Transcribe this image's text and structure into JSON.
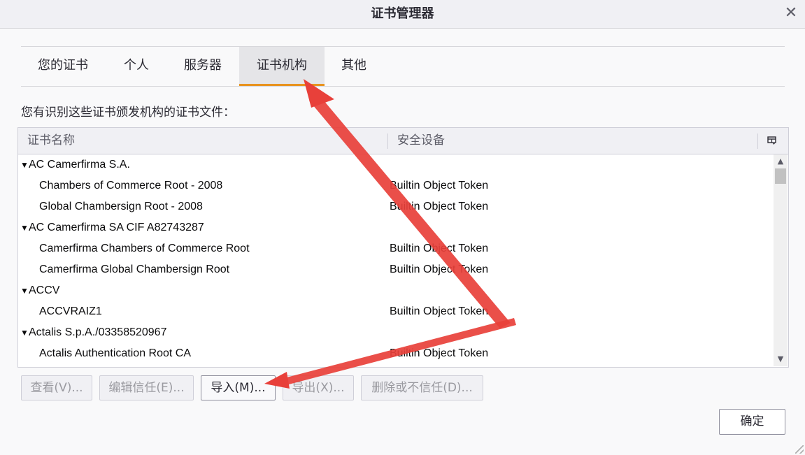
{
  "window": {
    "title": "证书管理器",
    "close_glyph": "✕"
  },
  "tabs": [
    {
      "label": "您的证书"
    },
    {
      "label": "个人"
    },
    {
      "label": "服务器"
    },
    {
      "label": "证书机构",
      "selected": true
    },
    {
      "label": "其他"
    }
  ],
  "intro_text": "您有识别这些证书颁发机构的证书文件：",
  "tree": {
    "columns": {
      "name": "证书名称",
      "device": "安全设备"
    },
    "column_picker_icon": "column-picker-icon",
    "rows": [
      {
        "kind": "parent",
        "name": "AC Camerfirma S.A.",
        "device": ""
      },
      {
        "kind": "child",
        "name": "Chambers of Commerce Root - 2008",
        "device": "Builtin Object Token"
      },
      {
        "kind": "child",
        "name": "Global Chambersign Root - 2008",
        "device": "Builtin Object Token"
      },
      {
        "kind": "parent",
        "name": "AC Camerfirma SA CIF A82743287",
        "device": ""
      },
      {
        "kind": "child",
        "name": "Camerfirma Chambers of Commerce Root",
        "device": "Builtin Object Token"
      },
      {
        "kind": "child",
        "name": "Camerfirma Global Chambersign Root",
        "device": "Builtin Object Token"
      },
      {
        "kind": "parent",
        "name": "ACCV",
        "device": ""
      },
      {
        "kind": "child",
        "name": "ACCVRAIZ1",
        "device": "Builtin Object Token"
      },
      {
        "kind": "parent",
        "name": "Actalis S.p.A./03358520967",
        "device": ""
      },
      {
        "kind": "child",
        "name": "Actalis Authentication Root CA",
        "device": "Builtin Object Token"
      }
    ]
  },
  "buttons": {
    "view": "查看(V)...",
    "edit_trust": "编辑信任(E)...",
    "import": "导入(M)...",
    "export": "导出(X)...",
    "delete": "删除或不信任(D)...",
    "ok": "确定"
  },
  "colors": {
    "accent": "#e8931f",
    "annotation_arrow": "#e8403a"
  }
}
